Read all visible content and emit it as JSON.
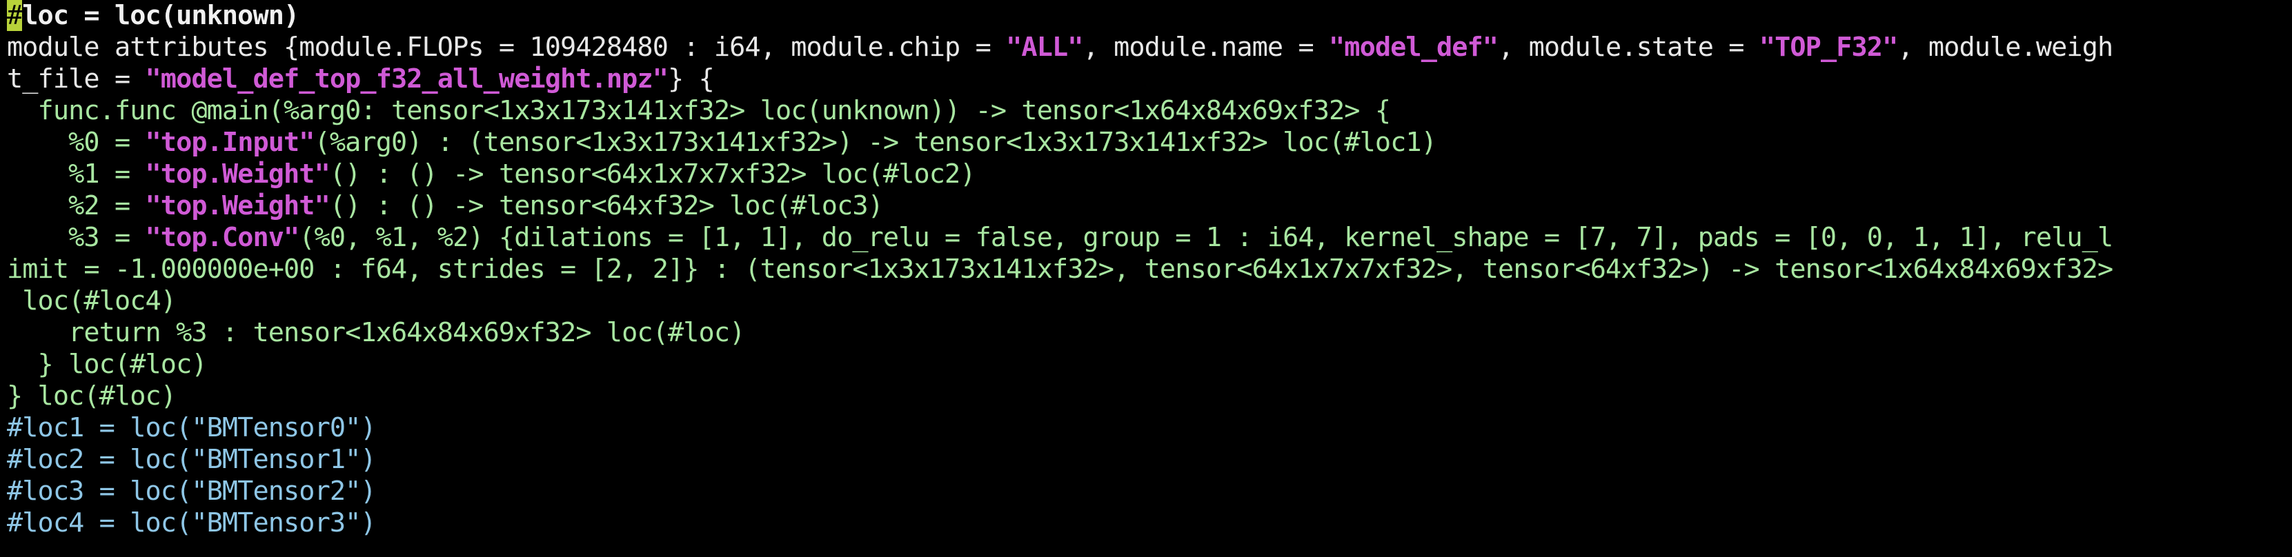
{
  "window": {
    "background": "#000000"
  },
  "palette": {
    "default": "#e8e8e8",
    "green": "#a8e6a1",
    "blue": "#8ec6e6",
    "magenta": "#d05ad6",
    "cursor": "#b8d23a"
  },
  "editor": {
    "lines": [
      {
        "segments": [
          {
            "text": "#",
            "style": "cursor"
          },
          {
            "text": "loc = loc(unknown)",
            "style": "white-bold"
          }
        ]
      },
      {
        "segments": [
          {
            "text": "module attributes {module.FLOPs = 109428480 : i64, module.chip = ",
            "style": "default"
          },
          {
            "text": "\"ALL\"",
            "style": "magenta"
          },
          {
            "text": ", module.name = ",
            "style": "default"
          },
          {
            "text": "\"model_def\"",
            "style": "magenta"
          },
          {
            "text": ", module.state = ",
            "style": "default"
          },
          {
            "text": "\"TOP_F32\"",
            "style": "magenta"
          },
          {
            "text": ", module.weigh",
            "style": "default"
          }
        ]
      },
      {
        "segments": [
          {
            "text": "t_file = ",
            "style": "default"
          },
          {
            "text": "\"model_def_top_f32_all_weight.npz\"",
            "style": "magenta"
          },
          {
            "text": "} {",
            "style": "default"
          }
        ]
      },
      {
        "segments": [
          {
            "text": "  func.func @main(%arg0: tensor<1x3x173x141xf32> loc(unknown)) -> tensor<1x64x84x69xf32> {",
            "style": "green"
          }
        ]
      },
      {
        "segments": [
          {
            "text": "    %0 = ",
            "style": "green"
          },
          {
            "text": "\"top.Input\"",
            "style": "magenta"
          },
          {
            "text": "(%arg0) : (tensor<1x3x173x141xf32>) -> tensor<1x3x173x141xf32> loc(#loc1)",
            "style": "green"
          }
        ]
      },
      {
        "segments": [
          {
            "text": "    %1 = ",
            "style": "green"
          },
          {
            "text": "\"top.Weight\"",
            "style": "magenta"
          },
          {
            "text": "() : () -> tensor<64x1x7x7xf32> loc(#loc2)",
            "style": "green"
          }
        ]
      },
      {
        "segments": [
          {
            "text": "    %2 = ",
            "style": "green"
          },
          {
            "text": "\"top.Weight\"",
            "style": "magenta"
          },
          {
            "text": "() : () -> tensor<64xf32> loc(#loc3)",
            "style": "green"
          }
        ]
      },
      {
        "segments": [
          {
            "text": "    %3 = ",
            "style": "green"
          },
          {
            "text": "\"top.Conv\"",
            "style": "magenta"
          },
          {
            "text": "(%0, %1, %2) {dilations = [1, 1], do_relu = false, group = 1 : i64, kernel_shape = [7, 7], pads = [0, 0, 1, 1], relu_l",
            "style": "green"
          }
        ]
      },
      {
        "segments": [
          {
            "text": "imit = -1.000000e+00 : f64, strides = [2, 2]} : (tensor<1x3x173x141xf32>, tensor<64x1x7x7xf32>, tensor<64xf32>) -> tensor<1x64x84x69xf32>",
            "style": "green"
          }
        ]
      },
      {
        "segments": [
          {
            "text": " loc(#loc4)",
            "style": "green"
          }
        ]
      },
      {
        "segments": [
          {
            "text": "    return %3 : tensor<1x64x84x69xf32> loc(#loc)",
            "style": "green"
          }
        ]
      },
      {
        "segments": [
          {
            "text": "  } loc(#loc)",
            "style": "green"
          }
        ]
      },
      {
        "segments": [
          {
            "text": "} loc(#loc)",
            "style": "green"
          }
        ]
      },
      {
        "segments": [
          {
            "text": "#loc1 = loc(\"BMTensor0\")",
            "style": "blue"
          }
        ]
      },
      {
        "segments": [
          {
            "text": "#loc2 = loc(\"BMTensor1\")",
            "style": "blue"
          }
        ]
      },
      {
        "segments": [
          {
            "text": "#loc3 = loc(\"BMTensor2\")",
            "style": "blue"
          }
        ]
      },
      {
        "segments": [
          {
            "text": "#loc4 = loc(\"BMTensor3\")",
            "style": "blue"
          }
        ]
      }
    ]
  }
}
